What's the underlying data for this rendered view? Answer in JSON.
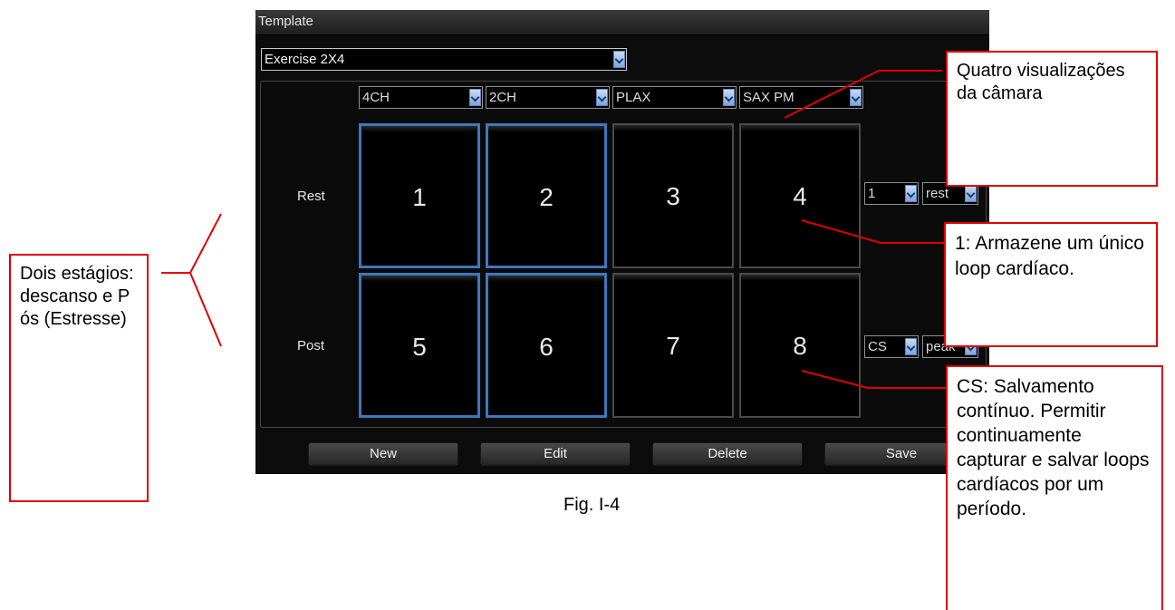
{
  "window": {
    "title": "Template"
  },
  "template_select": {
    "value": "Exercise 2X4"
  },
  "view_selects": [
    "4CH",
    "2CH",
    "PLAX",
    "SAX PM"
  ],
  "rows": [
    {
      "label": "Rest",
      "count": "1",
      "stage": "rest"
    },
    {
      "label": "Post",
      "count": "CS",
      "stage": "peak"
    }
  ],
  "cells": [
    "1",
    "2",
    "3",
    "4",
    "5",
    "6",
    "7",
    "8"
  ],
  "buttons": {
    "new": "New",
    "edit": "Edit",
    "delete": "Delete",
    "save": "Save"
  },
  "caption": "Fig. I-4",
  "callouts": {
    "views": "Quatro visualizações da câmara",
    "single": "1: Armazene um único loop cardíaco.",
    "cs": "CS: Salvamento contínuo. Permitir continuamente capturar e salvar loops cardíacos por um período.",
    "stages": "Dois estágios: descanso e Pós (Estresse)"
  },
  "colors": {
    "accent_blue": "#3e78bd",
    "callout_red": "#e00000"
  }
}
